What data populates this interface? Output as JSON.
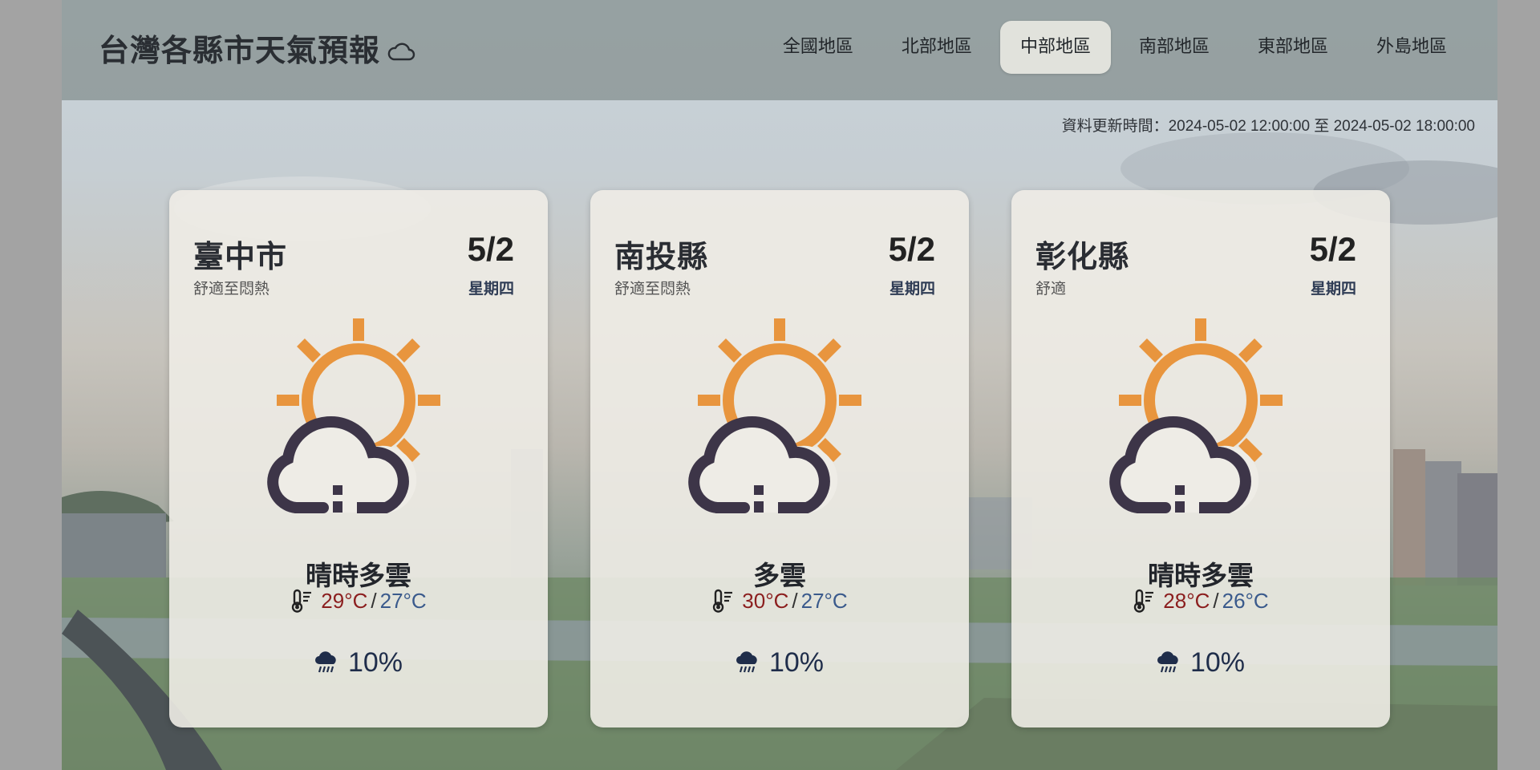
{
  "header": {
    "title": "台灣各縣市天氣預報",
    "title_icon": "cloud-icon",
    "nav": [
      {
        "label": "全國地區",
        "active": false
      },
      {
        "label": "北部地區",
        "active": false
      },
      {
        "label": "中部地區",
        "active": true
      },
      {
        "label": "南部地區",
        "active": false
      },
      {
        "label": "東部地區",
        "active": false
      },
      {
        "label": "外島地區",
        "active": false
      }
    ]
  },
  "update_time": "資料更新時間：2024-05-02 12:00:00 至 2024-05-02 18:00:00",
  "cards": [
    {
      "city": "臺中市",
      "comfort": "舒適至悶熱",
      "date": "5/2",
      "weekday": "星期四",
      "icon": "partly-cloudy-icon",
      "description": "晴時多雲",
      "max_temp": "29°C",
      "min_temp": "27°C",
      "rain": "10%"
    },
    {
      "city": "南投縣",
      "comfort": "舒適至悶熱",
      "date": "5/2",
      "weekday": "星期四",
      "icon": "partly-cloudy-icon",
      "description": "多雲",
      "max_temp": "30°C",
      "min_temp": "27°C",
      "rain": "10%"
    },
    {
      "city": "彰化縣",
      "comfort": "舒適",
      "date": "5/2",
      "weekday": "星期四",
      "icon": "partly-cloudy-icon",
      "description": "晴時多雲",
      "max_temp": "28°C",
      "min_temp": "26°C",
      "rain": "10%"
    }
  ],
  "colors": {
    "sun": "#e8953e",
    "cloud": "#3d3548",
    "max_temp": "#8b1e1e",
    "min_temp": "#3a5a8c",
    "active_nav_bg": "#ecebe4"
  }
}
